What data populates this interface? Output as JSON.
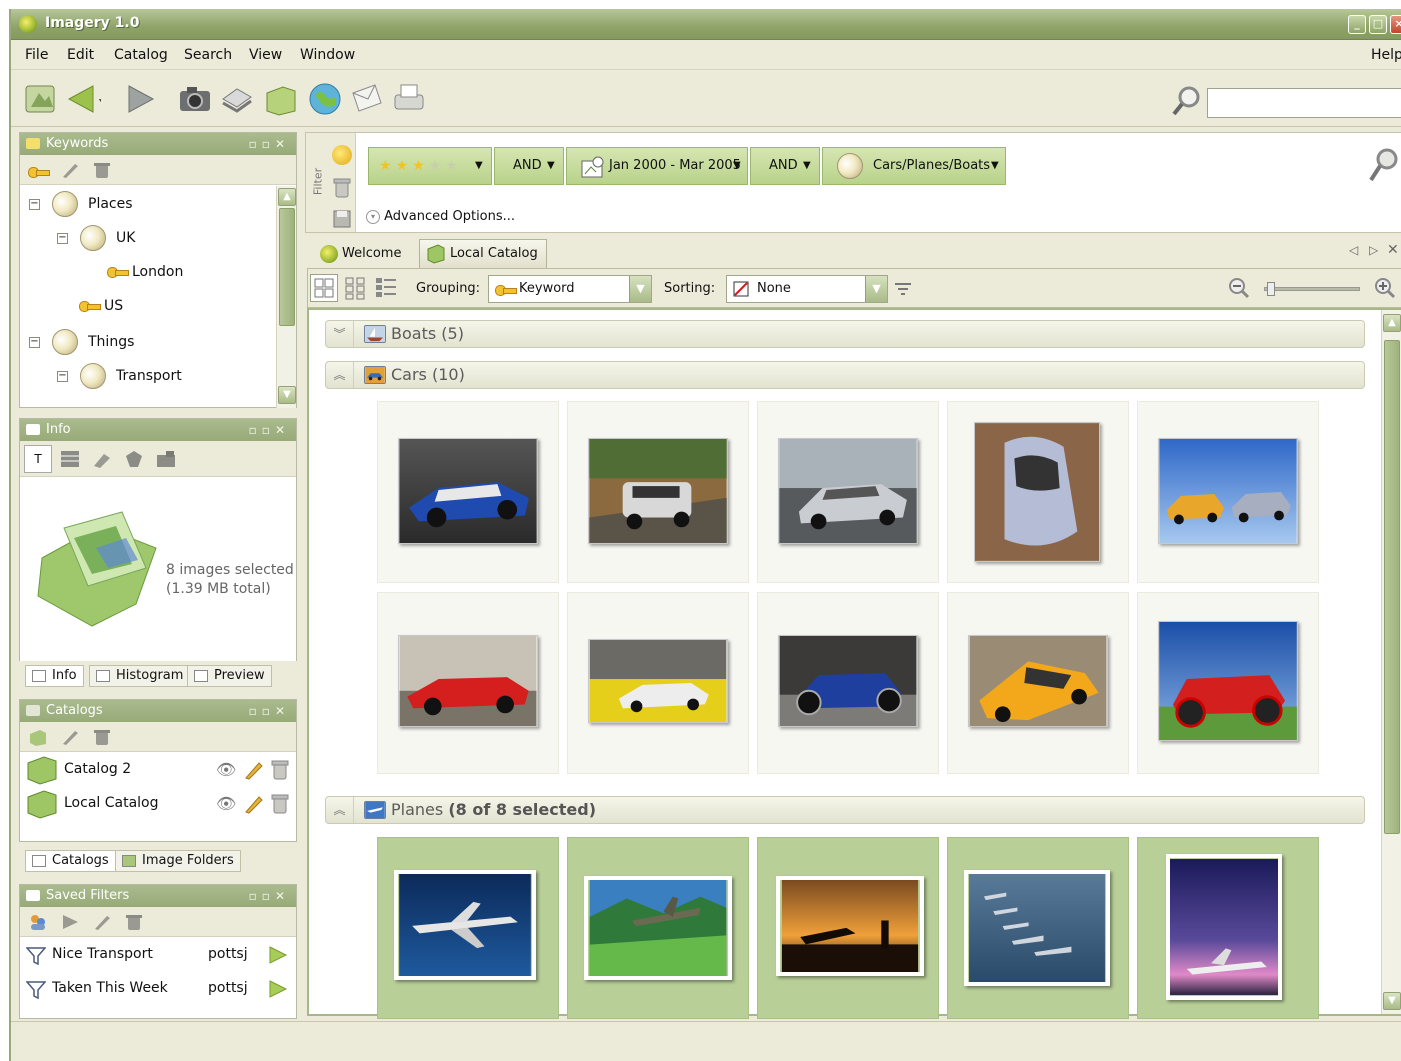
{
  "app": {
    "title": "Imagery 1.0"
  },
  "menu": [
    "File",
    "Edit",
    "Catalog",
    "Search",
    "View",
    "Window"
  ],
  "menu_help": "Help",
  "search": {
    "value": "",
    "placeholder": ""
  },
  "keywords_panel": {
    "title": "Keywords",
    "items": [
      {
        "label": "Places"
      },
      {
        "label": "UK"
      },
      {
        "label": "London"
      },
      {
        "label": "US"
      },
      {
        "label": "Things"
      },
      {
        "label": "Transport"
      }
    ]
  },
  "info_panel": {
    "title": "Info",
    "summary_line1": "8 images selected",
    "summary_line2": "(1.39 MB total)",
    "tabs": [
      "Info",
      "Histogram",
      "Preview"
    ]
  },
  "catalogs_panel": {
    "title": "Catalogs",
    "items": [
      {
        "name": "Catalog 2"
      },
      {
        "name": "Local Catalog"
      }
    ],
    "tabs": [
      "Catalogs",
      "Image Folders"
    ]
  },
  "saved_filters_panel": {
    "title": "Saved Filters",
    "items": [
      {
        "name": "Nice Transport",
        "owner": "pottsj"
      },
      {
        "name": "Taken This Week",
        "owner": "pottsj"
      }
    ]
  },
  "filter": {
    "side_label": "Filter",
    "rating": 3,
    "rating_max": 5,
    "op1": "AND",
    "date_range": "Jan 2000 - Mar 2005",
    "op2": "AND",
    "keyword_path": "Cars/Planes/Boats",
    "advanced": "Advanced Options..."
  },
  "tabs": [
    {
      "label": "Welcome"
    },
    {
      "label": "Local Catalog",
      "active": true
    }
  ],
  "viewbar": {
    "grouping_label": "Grouping:",
    "grouping_value": "Keyword",
    "sorting_label": "Sorting:",
    "sorting_value": "None",
    "zoom_level": 0.02
  },
  "groups": [
    {
      "name": "Boats",
      "count_text": "(5)",
      "expanded": false
    },
    {
      "name": "Cars",
      "count_text": "(10)",
      "expanded": true
    },
    {
      "name": "Planes",
      "count_text": "(8 of 8 selected)",
      "expanded": true
    }
  ],
  "colors": {
    "accent": "#97aa78",
    "selection": "#b8cf98",
    "chrome": "#ecead9",
    "titlebar": "#8fa36a"
  },
  "icons": [
    "app-icon",
    "back-icon",
    "forward-icon",
    "camera-icon",
    "scanner-icon",
    "catalog-icon",
    "globe-icon",
    "mail-icon",
    "printer-icon",
    "search-icon",
    "key-icon",
    "pencil-icon",
    "trash-icon",
    "eye-icon",
    "play-icon",
    "funnel-icon",
    "zoom-in-icon",
    "zoom-out-icon"
  ]
}
